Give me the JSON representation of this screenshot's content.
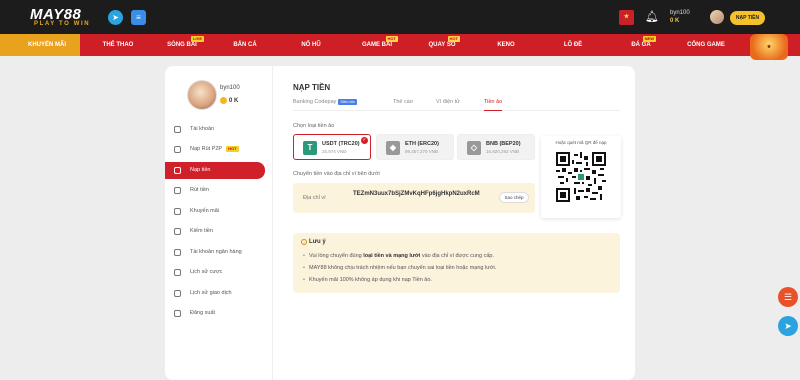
{
  "header": {
    "logo_text": "MAY88",
    "logo_tagline": "PLAY TO WIN",
    "username": "byn100",
    "balance": "0 K",
    "deposit_button": "NẠP TIỀN",
    "icons": [
      "telegram-icon",
      "chat-icon",
      "gift-icon",
      "bell-icon"
    ]
  },
  "nav": {
    "items": [
      {
        "label": "KHUYẾN MÃI",
        "tag": ""
      },
      {
        "label": "THỂ THAO",
        "tag": ""
      },
      {
        "label": "SÒNG BÀI",
        "tag": "LIVE"
      },
      {
        "label": "BẮN CÁ",
        "tag": ""
      },
      {
        "label": "NỔ HŨ",
        "tag": ""
      },
      {
        "label": "GAME BÀI",
        "tag": "HOT"
      },
      {
        "label": "QUAY SỐ",
        "tag": "HOT"
      },
      {
        "label": "KENO",
        "tag": ""
      },
      {
        "label": "LÔ ĐỀ",
        "tag": ""
      },
      {
        "label": "ĐÁ GÀ",
        "tag": "NEW"
      },
      {
        "label": "CỔNG GAME",
        "tag": ""
      }
    ]
  },
  "sidebar": {
    "username": "byn100",
    "balance": "0 K",
    "items": [
      {
        "label": "Tài khoản",
        "hot": ""
      },
      {
        "label": "Nạp Rút P2P",
        "hot": "HOT"
      },
      {
        "label": "Nạp tiền",
        "hot": ""
      },
      {
        "label": "Rút tiền",
        "hot": ""
      },
      {
        "label": "Khuyến mãi",
        "hot": ""
      },
      {
        "label": "Kiếm tiền",
        "hot": ""
      },
      {
        "label": "Tài khoản ngân hàng",
        "hot": ""
      },
      {
        "label": "Lịch sử cược",
        "hot": ""
      },
      {
        "label": "Lịch sử giao dịch",
        "hot": ""
      },
      {
        "label": "Đăng xuất",
        "hot": ""
      }
    ],
    "active_index": 2
  },
  "main": {
    "title": "NẠP TIỀN",
    "tabs": [
      {
        "label": "Banking Codepay",
        "badge": "Siêu tốc"
      },
      {
        "label": "Thẻ cào",
        "badge": ""
      },
      {
        "label": "Ví điện tử",
        "badge": ""
      },
      {
        "label": "Tiền ảo",
        "badge": ""
      }
    ],
    "active_tab": 3,
    "choose_label": "Chọn loại tiền ảo",
    "tokens": [
      {
        "name": "USDT (TRC20)",
        "rate": "25,974 VNĐ",
        "selected": true
      },
      {
        "name": "ETH (ERC20)",
        "rate": "99,357,270 VNĐ",
        "selected": false
      },
      {
        "name": "BNB (BEP20)",
        "rate": "16,920,292 VNĐ",
        "selected": false
      }
    ],
    "transfer_label": "Chuyển tiền vào địa chỉ ví bên dưới",
    "address_label": "Địa chỉ ví",
    "address_value": "TEZmN3uux7bSjZMvKqHFp6jgHkpN2uxRcM",
    "copy_button": "Sao chép",
    "qr_title": "Hoặc quét mã QR để nạp",
    "note": {
      "title": "Lưu ý",
      "line1_prefix": "Vui lòng chuyển đúng ",
      "line1_bold": "loại tiền và mạng lưới",
      "line1_suffix": " vào địa chỉ ví được cung cấp.",
      "line2": "MAY88 không chịu trách nhiệm nếu bạn chuyển sai loại tiền hoặc mạng lưới.",
      "line3": "Khuyến mãi 100% không áp dụng khi nạp Tiền ảo."
    }
  },
  "colors": {
    "brand_red": "#d0202a",
    "accent_yellow": "#f4c12a",
    "note_bg": "#fcf3dd"
  }
}
